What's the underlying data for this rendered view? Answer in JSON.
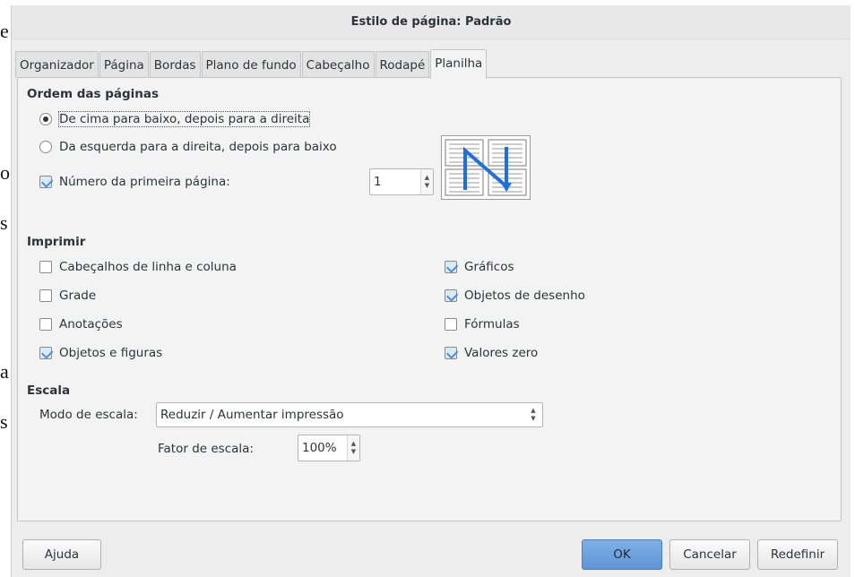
{
  "background_fragments": [
    "e",
    "o",
    "s",
    "a",
    "s"
  ],
  "dialog": {
    "title": "Estilo de página: Padrão"
  },
  "tabs": [
    {
      "label": "Organizador",
      "active": false
    },
    {
      "label": "Página",
      "active": false
    },
    {
      "label": "Bordas",
      "active": false
    },
    {
      "label": "Plano de fundo",
      "active": false
    },
    {
      "label": "Cabeçalho",
      "active": false
    },
    {
      "label": "Rodapé",
      "active": false
    },
    {
      "label": "Planilha",
      "active": true
    }
  ],
  "page_order": {
    "title": "Ordem das páginas",
    "option_top_down": "De cima para baixo, depois para a direita",
    "option_left_right": "Da esquerda para a direita, depois para baixo",
    "selected": "top_down",
    "first_page_label": "Número da primeira página:",
    "first_page_checked": true,
    "first_page_value": "1"
  },
  "print": {
    "title": "Imprimir",
    "left_items": [
      {
        "label": "Cabeçalhos de linha e coluna",
        "checked": false
      },
      {
        "label": "Grade",
        "checked": false
      },
      {
        "label": "Anotações",
        "checked": false
      },
      {
        "label": "Objetos e figuras",
        "checked": true
      }
    ],
    "right_items": [
      {
        "label": "Gráficos",
        "checked": true
      },
      {
        "label": "Objetos de desenho",
        "checked": true
      },
      {
        "label": "Fórmulas",
        "checked": false
      },
      {
        "label": "Valores zero",
        "checked": true
      }
    ]
  },
  "scale": {
    "title": "Escala",
    "mode_label": "Modo de escala:",
    "mode_value": "Reduzir / Aumentar impressão",
    "factor_label": "Fator de escala:",
    "factor_value": "100%"
  },
  "buttons": {
    "help": "Ajuda",
    "ok": "OK",
    "cancel": "Cancelar",
    "reset": "Redefinir"
  },
  "colors": {
    "accent": "#4a90d9",
    "ok_button": "#6fa3df",
    "preview_arrow": "#1e6fd9"
  }
}
